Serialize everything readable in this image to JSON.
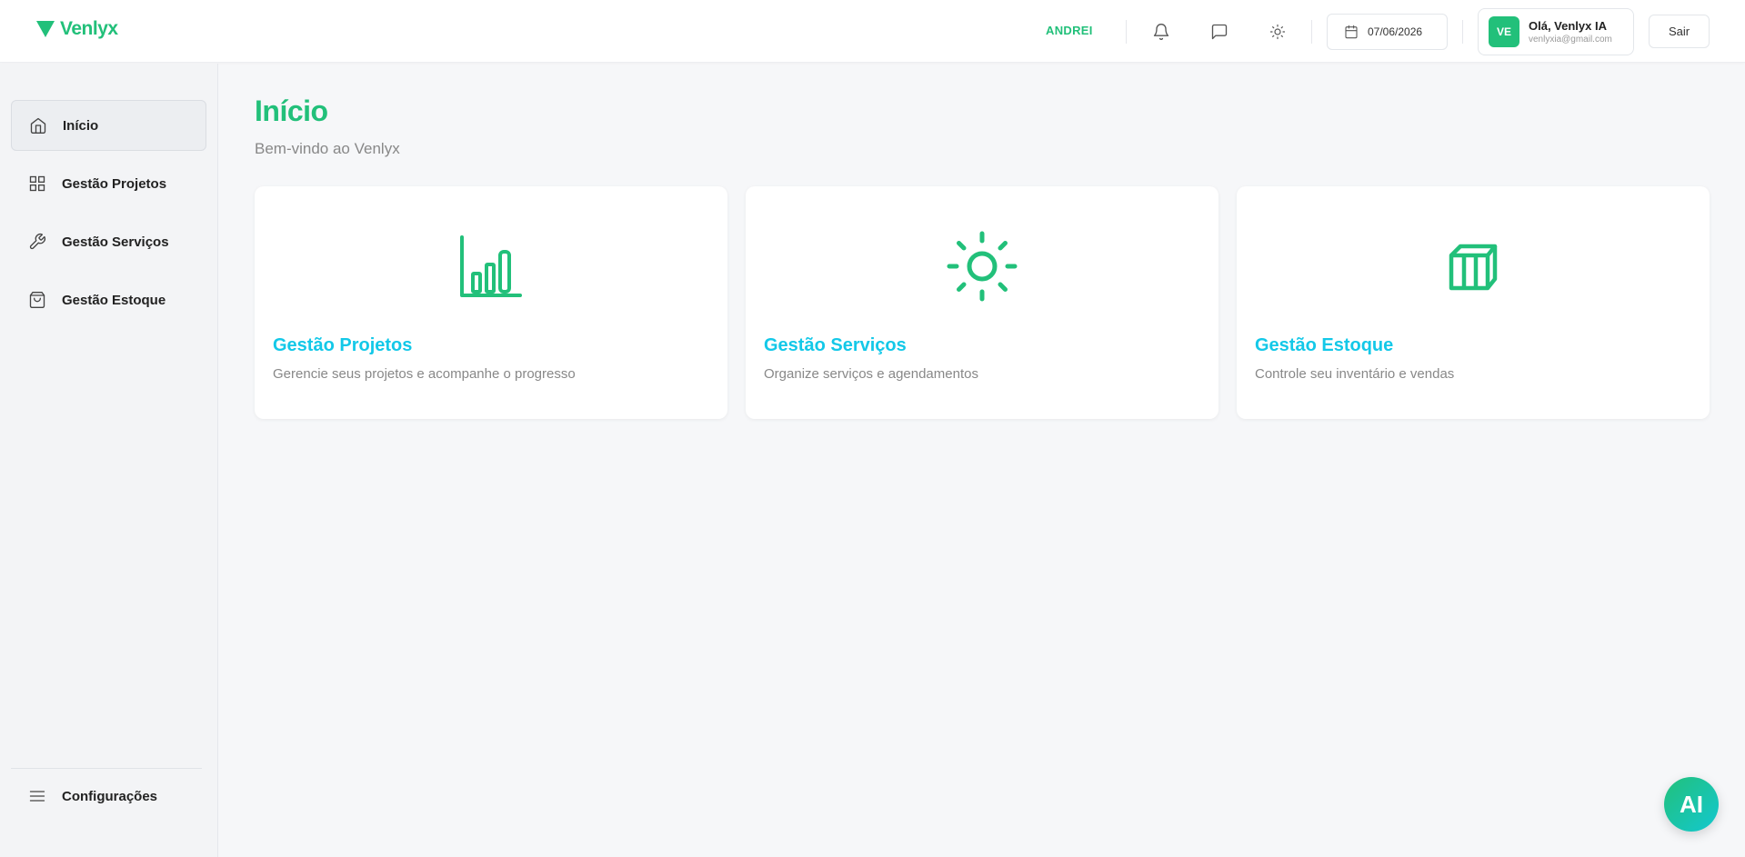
{
  "header": {
    "logo_text": "Venlyx",
    "user_link": "ANDREI",
    "date": "07/06/2026",
    "profile": {
      "initials": "VE",
      "greeting": "Olá, Venlyx IA",
      "email": "venlyxia@gmail.com"
    },
    "logout_label": "Sair"
  },
  "sidebar": {
    "items": [
      {
        "label": "Início",
        "icon": "home-icon",
        "active": true
      },
      {
        "label": "Gestão Projetos",
        "icon": "grid-icon"
      },
      {
        "label": "Gestão Serviços",
        "icon": "wrench-icon"
      },
      {
        "label": "Gestão Estoque",
        "icon": "shopping-bag-icon"
      }
    ],
    "settings_label": "Configurações"
  },
  "main": {
    "title": "Início",
    "subtitle": "Bem-vindo ao Venlyx",
    "cards": [
      {
        "title": "Gestão Projetos",
        "description": "Gerencie seus projetos e acompanhe o progresso",
        "icon": "bar-chart-icon"
      },
      {
        "title": "Gestão Serviços",
        "description": "Organize serviços e agendamentos",
        "icon": "sun-icon"
      },
      {
        "title": "Gestão Estoque",
        "description": "Controle seu inventário e vendas",
        "icon": "box-icon"
      }
    ]
  },
  "ai_button_label": "AI",
  "colors": {
    "brand": "#22c07a",
    "card_title": "#13c8e8"
  }
}
